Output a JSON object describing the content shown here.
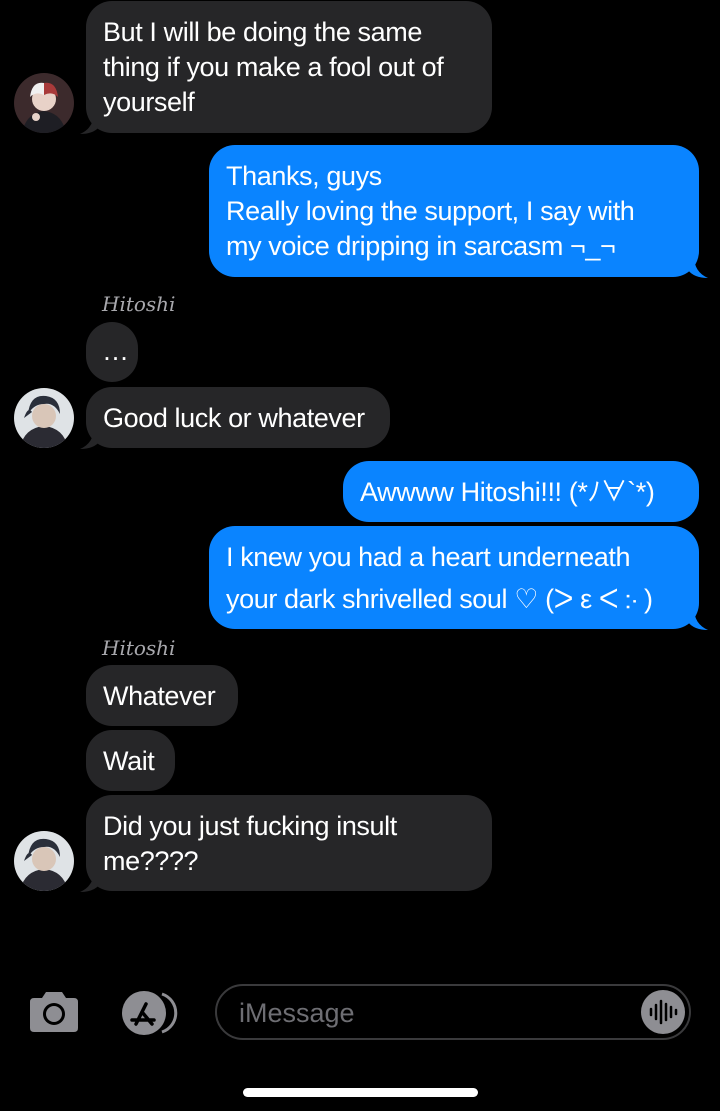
{
  "messages": [
    {
      "text": "But I will be doing the same\nthing if you make a fool out of\nyourself"
    },
    {
      "text": "Thanks, guys\nReally loving the support, I say with\nmy voice dripping in sarcasm ¬_¬"
    },
    {
      "sender": "Hitoshi"
    },
    {
      "text": "…"
    },
    {
      "text": "Good luck or whatever"
    },
    {
      "text": "Awwww Hitoshi!!! (*ﾉ∀`*)"
    },
    {
      "text": "I knew you had a heart underneath\nyour dark shrivelled soul ♡ (ᐳ ε ᐸ ჻ )"
    },
    {
      "sender": "Hitoshi"
    },
    {
      "text": "Whatever"
    },
    {
      "text": "Wait"
    },
    {
      "text": "Did you just fucking insult\nme????"
    }
  ],
  "composer": {
    "placeholder": "iMessage",
    "camera_icon": "camera-icon",
    "appstore_icon": "app-store-icon",
    "audio_icon": "audio-waveform-icon"
  },
  "colors": {
    "incoming_bubble": "#262628",
    "outgoing_bubble": "#0a84ff",
    "background": "#000000"
  }
}
